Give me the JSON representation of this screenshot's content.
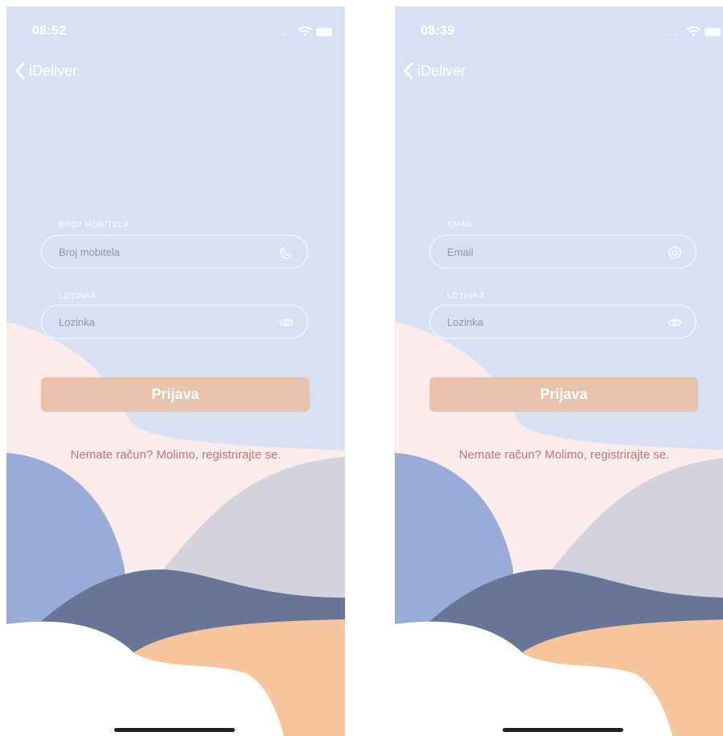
{
  "screens": [
    {
      "status": {
        "time": "08:52",
        "signal_icon": "signal-dots-icon",
        "wifi_icon": "wifi-icon",
        "battery_icon": "battery-icon"
      },
      "nav": {
        "back_label": "iDeliver"
      },
      "fields": [
        {
          "label": "BROJ MOBITELA",
          "placeholder": "Broj mobitela",
          "icon": "phone-icon"
        },
        {
          "label": "LOZINKA",
          "placeholder": "Lozinka",
          "icon": "eye-icon"
        }
      ],
      "login_label": "Prijava",
      "register_text": "Nemate račun? Molimo, registrirajte se."
    },
    {
      "status": {
        "time": "08:39",
        "signal_icon": "signal-dots-icon",
        "wifi_icon": "wifi-icon",
        "battery_icon": "battery-icon"
      },
      "nav": {
        "back_label": "iDeliver"
      },
      "fields": [
        {
          "label": "EMAIL",
          "placeholder": "Email",
          "icon": "at-icon"
        },
        {
          "label": "LOZINKA",
          "placeholder": "Lozinka",
          "icon": "eye-icon"
        }
      ],
      "login_label": "Prijava",
      "register_text": "Nemate račun? Molimo, registrirajte se."
    }
  ],
  "colors": {
    "background": "#d8e1f3",
    "blush": "#fbecec",
    "periwinkle": "#99abd6",
    "grey": "#d4d2db",
    "navy": "#687595",
    "peach": "#f6c59b",
    "button": "#e8c3ab",
    "link": "#c5757c"
  }
}
